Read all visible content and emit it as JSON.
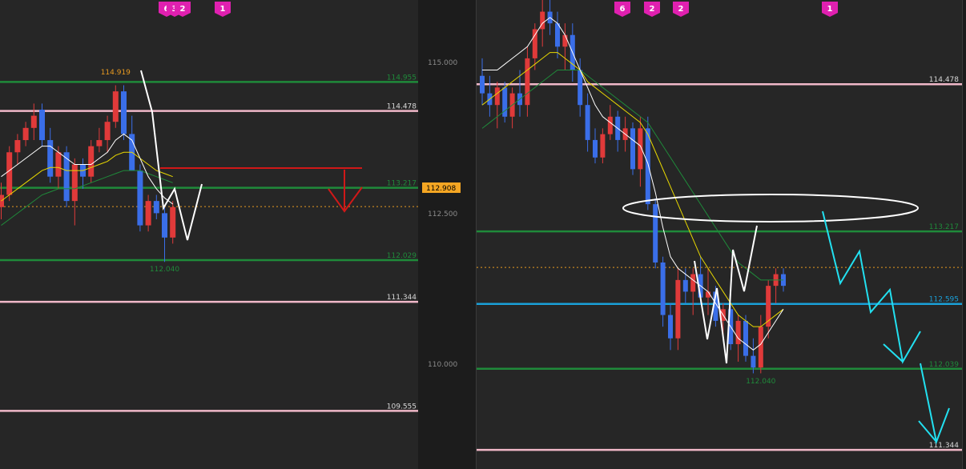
{
  "colors": {
    "bg_panel": "#262626",
    "bg_page": "#1c1c1c",
    "green_level": "#1f8a3a",
    "pink_level": "#f0b8c8",
    "blue_level": "#1aa0d8",
    "bull_candle": "#e03a3a",
    "bear_candle": "#3a6ee8",
    "ma_fast": "#ffffff",
    "ma_mid": "#e8d800",
    "ma_slow": "#1f8a3a",
    "orange_dotted": "#e89a20",
    "price_tag_bg": "#f5a623",
    "marker_bg": "#e020b0",
    "cyan_projection": "#22e0f0",
    "red_projection": "#d01818"
  },
  "price_axis": {
    "ticks": [
      "115.000",
      "112.500",
      "110.000"
    ],
    "current_price": "112.908"
  },
  "chart_data": [
    {
      "type": "candlestick",
      "name": "left-chart",
      "ylim": [
        108.6,
        116.3
      ],
      "levels": [
        {
          "price": 114.955,
          "label": "114.955",
          "color": "green"
        },
        {
          "price": 114.478,
          "label": "114.478",
          "color": "pink"
        },
        {
          "price": 113.217,
          "label": "113.217",
          "color": "green"
        },
        {
          "price": 112.029,
          "label": "112.029",
          "color": "green"
        },
        {
          "price": 111.344,
          "label": "111.344",
          "color": "pink"
        },
        {
          "price": 109.555,
          "label": "109.555",
          "color": "pink"
        }
      ],
      "annotations": [
        {
          "text": "114.919",
          "price": 115.0,
          "candle": 14,
          "color": "orange"
        },
        {
          "text": "112.040",
          "price": 111.95,
          "candle": 20,
          "color": "green"
        }
      ],
      "markers": [
        "6",
        "3",
        "2",
        "1"
      ],
      "candles": [
        [
          112.9,
          113.3,
          112.7,
          113.1
        ],
        [
          113.1,
          113.9,
          113.0,
          113.8
        ],
        [
          113.8,
          114.1,
          113.6,
          114.0
        ],
        [
          114.0,
          114.3,
          113.9,
          114.2
        ],
        [
          114.2,
          114.6,
          114.0,
          114.4
        ],
        [
          114.5,
          114.6,
          113.9,
          114.0
        ],
        [
          114.0,
          114.2,
          113.3,
          113.4
        ],
        [
          113.4,
          113.9,
          113.2,
          113.8
        ],
        [
          113.8,
          113.9,
          112.9,
          113.0
        ],
        [
          113.0,
          113.7,
          112.6,
          113.6
        ],
        [
          113.6,
          113.7,
          113.2,
          113.4
        ],
        [
          113.4,
          114.0,
          113.3,
          113.9
        ],
        [
          113.9,
          114.2,
          113.8,
          114.0
        ],
        [
          114.0,
          114.4,
          113.8,
          114.3
        ],
        [
          114.3,
          114.9,
          114.2,
          114.8
        ],
        [
          114.8,
          114.9,
          114.0,
          114.1
        ],
        [
          114.1,
          114.4,
          113.5,
          113.5
        ],
        [
          113.5,
          113.6,
          112.5,
          112.6
        ],
        [
          112.6,
          113.1,
          112.5,
          113.0
        ],
        [
          113.0,
          113.1,
          112.7,
          112.8
        ],
        [
          112.8,
          112.9,
          112.0,
          112.4
        ],
        [
          112.4,
          113.0,
          112.3,
          112.9
        ]
      ],
      "ma_fast": [
        113.4,
        113.5,
        113.6,
        113.7,
        113.8,
        113.9,
        113.9,
        113.8,
        113.7,
        113.6,
        113.6,
        113.6,
        113.7,
        113.8,
        114.0,
        114.1,
        114.0,
        113.7,
        113.4,
        113.2,
        113.05,
        112.95
      ],
      "ma_mid": [
        113.0,
        113.1,
        113.2,
        113.3,
        113.4,
        113.5,
        113.55,
        113.55,
        113.5,
        113.5,
        113.5,
        113.55,
        113.6,
        113.65,
        113.75,
        113.8,
        113.8,
        113.7,
        113.6,
        113.5,
        113.45,
        113.4
      ],
      "ma_slow": [
        112.6,
        112.7,
        112.8,
        112.9,
        113.0,
        113.1,
        113.15,
        113.2,
        113.2,
        113.2,
        113.25,
        113.3,
        113.35,
        113.4,
        113.45,
        113.5,
        113.5,
        113.5,
        113.45,
        113.4,
        113.35,
        113.3
      ]
    },
    {
      "type": "candlestick",
      "name": "right-chart",
      "ylim": [
        111.18,
        115.2
      ],
      "levels": [
        {
          "price": 114.478,
          "label": "114.478",
          "color": "pink"
        },
        {
          "price": 113.217,
          "label": "113.217",
          "color": "green"
        },
        {
          "price": 112.595,
          "label": "112.595",
          "color": "blue"
        },
        {
          "price": 112.039,
          "label": "112.039",
          "color": "green"
        },
        {
          "price": 111.344,
          "label": "111.344",
          "color": "pink"
        }
      ],
      "annotations": [
        {
          "text": "112.040",
          "price": 111.97,
          "candle": 37,
          "color": "green"
        }
      ],
      "markers": [
        "6",
        "2",
        "2",
        "1"
      ],
      "candles": [
        [
          114.55,
          114.7,
          114.3,
          114.4
        ],
        [
          114.4,
          114.55,
          114.2,
          114.3
        ],
        [
          114.3,
          114.5,
          114.1,
          114.45
        ],
        [
          114.45,
          114.5,
          114.15,
          114.2
        ],
        [
          114.2,
          114.45,
          114.1,
          114.4
        ],
        [
          114.4,
          114.6,
          114.2,
          114.3
        ],
        [
          114.3,
          114.8,
          114.2,
          114.7
        ],
        [
          114.7,
          115.0,
          114.6,
          114.95
        ],
        [
          114.95,
          115.2,
          114.8,
          115.1
        ],
        [
          115.1,
          115.2,
          114.9,
          115.0
        ],
        [
          115.0,
          115.1,
          114.7,
          114.8
        ],
        [
          114.8,
          115.0,
          114.6,
          114.9
        ],
        [
          114.9,
          115.0,
          114.5,
          114.6
        ],
        [
          114.6,
          114.7,
          114.2,
          114.3
        ],
        [
          114.3,
          114.4,
          113.9,
          114.0
        ],
        [
          114.0,
          114.1,
          113.8,
          113.85
        ],
        [
          113.85,
          114.1,
          113.8,
          114.05
        ],
        [
          114.05,
          114.3,
          114.0,
          114.2
        ],
        [
          114.2,
          114.25,
          113.9,
          114.0
        ],
        [
          114.0,
          114.2,
          113.9,
          114.1
        ],
        [
          114.1,
          114.15,
          113.7,
          113.75
        ],
        [
          113.75,
          114.2,
          113.6,
          114.1
        ],
        [
          114.1,
          114.2,
          113.4,
          113.45
        ],
        [
          113.45,
          113.5,
          112.9,
          112.95
        ],
        [
          112.95,
          113.0,
          112.4,
          112.5
        ],
        [
          112.5,
          112.6,
          112.2,
          112.3
        ],
        [
          112.3,
          112.9,
          112.2,
          112.8
        ],
        [
          112.8,
          112.9,
          112.6,
          112.7
        ],
        [
          112.7,
          112.9,
          112.5,
          112.85
        ],
        [
          112.85,
          113.0,
          112.6,
          112.65
        ],
        [
          112.65,
          112.9,
          112.5,
          112.7
        ],
        [
          112.7,
          112.75,
          112.4,
          112.45
        ],
        [
          112.45,
          112.6,
          112.3,
          112.55
        ],
        [
          112.55,
          112.6,
          112.2,
          112.25
        ],
        [
          112.25,
          112.5,
          112.1,
          112.45
        ],
        [
          112.45,
          112.5,
          112.1,
          112.15
        ],
        [
          112.15,
          112.3,
          112.0,
          112.05
        ],
        [
          112.05,
          112.5,
          112.0,
          112.4
        ],
        [
          112.4,
          112.8,
          112.3,
          112.75
        ],
        [
          112.75,
          112.9,
          112.6,
          112.85
        ],
        [
          112.85,
          112.9,
          112.7,
          112.75
        ]
      ],
      "ma_fast": [
        114.6,
        114.6,
        114.6,
        114.65,
        114.7,
        114.75,
        114.8,
        114.9,
        115.0,
        115.05,
        115.0,
        114.9,
        114.75,
        114.6,
        114.45,
        114.3,
        114.2,
        114.15,
        114.1,
        114.05,
        114.0,
        113.95,
        113.8,
        113.55,
        113.25,
        113.0,
        112.9,
        112.85,
        112.8,
        112.75,
        112.7,
        112.6,
        112.5,
        112.4,
        112.3,
        112.25,
        112.2,
        112.25,
        112.35,
        112.45,
        112.55
      ],
      "ma_mid": [
        114.3,
        114.35,
        114.4,
        114.45,
        114.5,
        114.55,
        114.6,
        114.65,
        114.7,
        114.75,
        114.75,
        114.7,
        114.65,
        114.6,
        114.5,
        114.45,
        114.4,
        114.35,
        114.3,
        114.25,
        114.2,
        114.15,
        114.05,
        113.9,
        113.75,
        113.6,
        113.45,
        113.3,
        113.15,
        113.0,
        112.9,
        112.8,
        112.7,
        112.6,
        112.5,
        112.45,
        112.4,
        112.4,
        112.45,
        112.5,
        112.55
      ],
      "ma_slow": [
        114.1,
        114.15,
        114.2,
        114.25,
        114.3,
        114.35,
        114.4,
        114.45,
        114.5,
        114.55,
        114.6,
        114.6,
        114.6,
        114.6,
        114.55,
        114.5,
        114.45,
        114.4,
        114.35,
        114.3,
        114.25,
        114.2,
        114.15,
        114.05,
        113.95,
        113.85,
        113.75,
        113.65,
        113.55,
        113.45,
        113.35,
        113.25,
        113.15,
        113.05,
        112.95,
        112.9,
        112.85,
        112.8,
        112.8,
        112.8,
        112.8
      ]
    }
  ]
}
